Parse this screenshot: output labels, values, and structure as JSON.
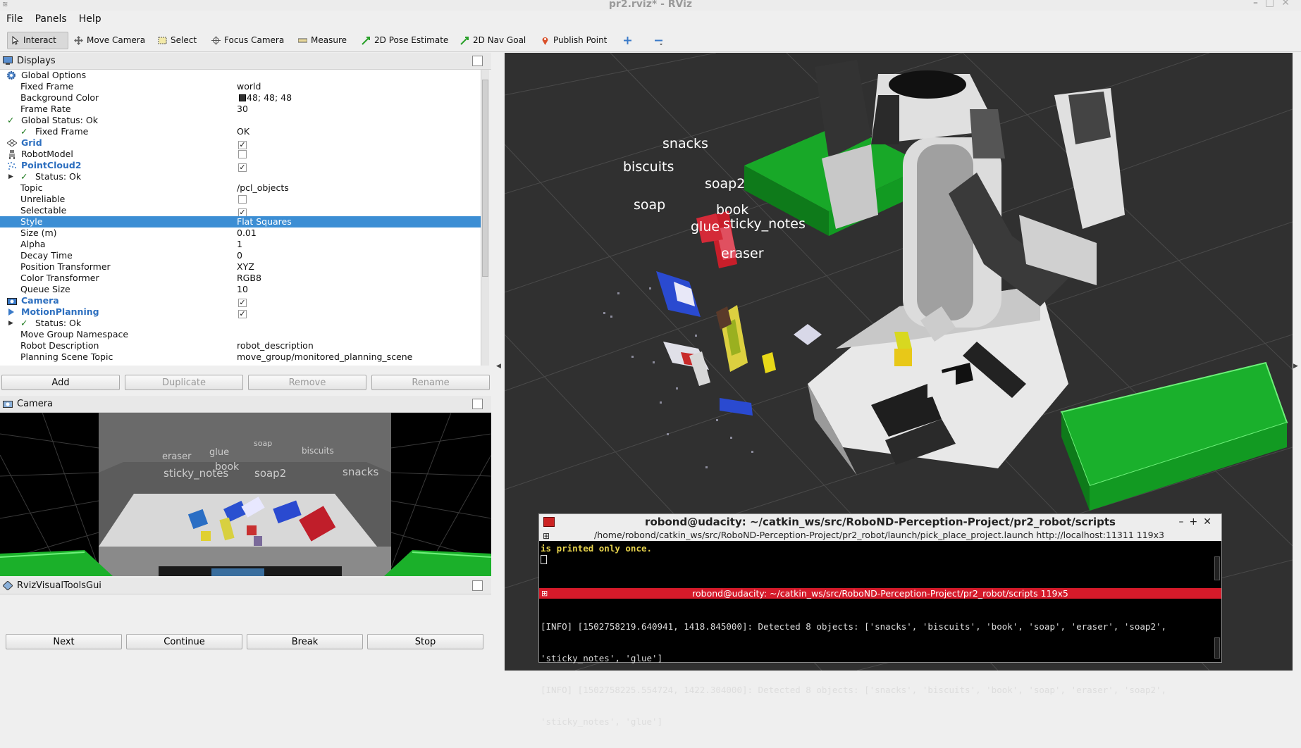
{
  "window": {
    "title": "pr2.rviz* - RViz"
  },
  "menu": [
    "File",
    "Panels",
    "Help"
  ],
  "toolbar": {
    "items": [
      "Interact",
      "Move Camera",
      "Select",
      "Focus Camera",
      "Measure",
      "2D Pose Estimate",
      "2D Nav Goal",
      "Publish Point"
    ]
  },
  "displays": {
    "title": "Displays",
    "rows": [
      {
        "k": "Global Options",
        "v": ""
      },
      {
        "k": "Fixed Frame",
        "v": "world"
      },
      {
        "k": "Background Color",
        "v": "48; 48; 48"
      },
      {
        "k": "Frame Rate",
        "v": "30"
      },
      {
        "k": "Global Status: Ok",
        "v": ""
      },
      {
        "k": "Fixed Frame",
        "v": "OK"
      },
      {
        "k": "Grid",
        "v": ""
      },
      {
        "k": "RobotModel",
        "v": ""
      },
      {
        "k": "PointCloud2",
        "v": ""
      },
      {
        "k": "Status: Ok",
        "v": ""
      },
      {
        "k": "Topic",
        "v": "/pcl_objects"
      },
      {
        "k": "Unreliable",
        "v": ""
      },
      {
        "k": "Selectable",
        "v": ""
      },
      {
        "k": "Style",
        "v": "Flat Squares"
      },
      {
        "k": "Size (m)",
        "v": "0.01"
      },
      {
        "k": "Alpha",
        "v": "1"
      },
      {
        "k": "Decay Time",
        "v": "0"
      },
      {
        "k": "Position Transformer",
        "v": "XYZ"
      },
      {
        "k": "Color Transformer",
        "v": "RGB8"
      },
      {
        "k": "Queue Size",
        "v": "10"
      },
      {
        "k": "Camera",
        "v": ""
      },
      {
        "k": "MotionPlanning",
        "v": ""
      },
      {
        "k": "Status: Ok",
        "v": ""
      },
      {
        "k": "Move Group Namespace",
        "v": ""
      },
      {
        "k": "Robot Description",
        "v": "robot_description"
      },
      {
        "k": "Planning Scene Topic",
        "v": "move_group/monitored_planning_scene"
      }
    ],
    "buttons": [
      "Add",
      "Duplicate",
      "Remove",
      "Rename"
    ]
  },
  "camera": {
    "title": "Camera",
    "labels": [
      "eraser",
      "glue",
      "soap",
      "biscuits",
      "book",
      "sticky_notes",
      "soap2",
      "snacks"
    ]
  },
  "rviz_gui": {
    "title": "RvizVisualToolsGui",
    "buttons": [
      "Next",
      "Continue",
      "Break",
      "Stop"
    ]
  },
  "scene_labels": [
    "snacks",
    "biscuits",
    "soap2",
    "soap",
    "book",
    "glue",
    "sticky_notes",
    "eraser"
  ],
  "terminal": {
    "title": "robond@udacity: ~/catkin_ws/src/RoboND-Perception-Project/pr2_robot/scripts",
    "tab": "/home/robond/catkin_ws/src/RoboND-Perception-Project/pr2_robot/launch/pick_place_project.launch http://localhost:11311 119x3",
    "pane1": "is printed only once.",
    "pane2_title": "robond@udacity: ~/catkin_ws/src/RoboND-Perception-Project/pr2_robot/scripts 119x5",
    "pane2_lines": [
      "[INFO] [1502758219.640941, 1418.845000]: Detected 8 objects: ['snacks', 'biscuits', 'book', 'soap', 'eraser', 'soap2',",
      "'sticky_notes', 'glue']",
      "[INFO] [1502758225.554724, 1422.304000]: Detected 8 objects: ['snacks', 'biscuits', 'book', 'soap', 'eraser', 'soap2',",
      "'sticky_notes', 'glue']"
    ]
  }
}
